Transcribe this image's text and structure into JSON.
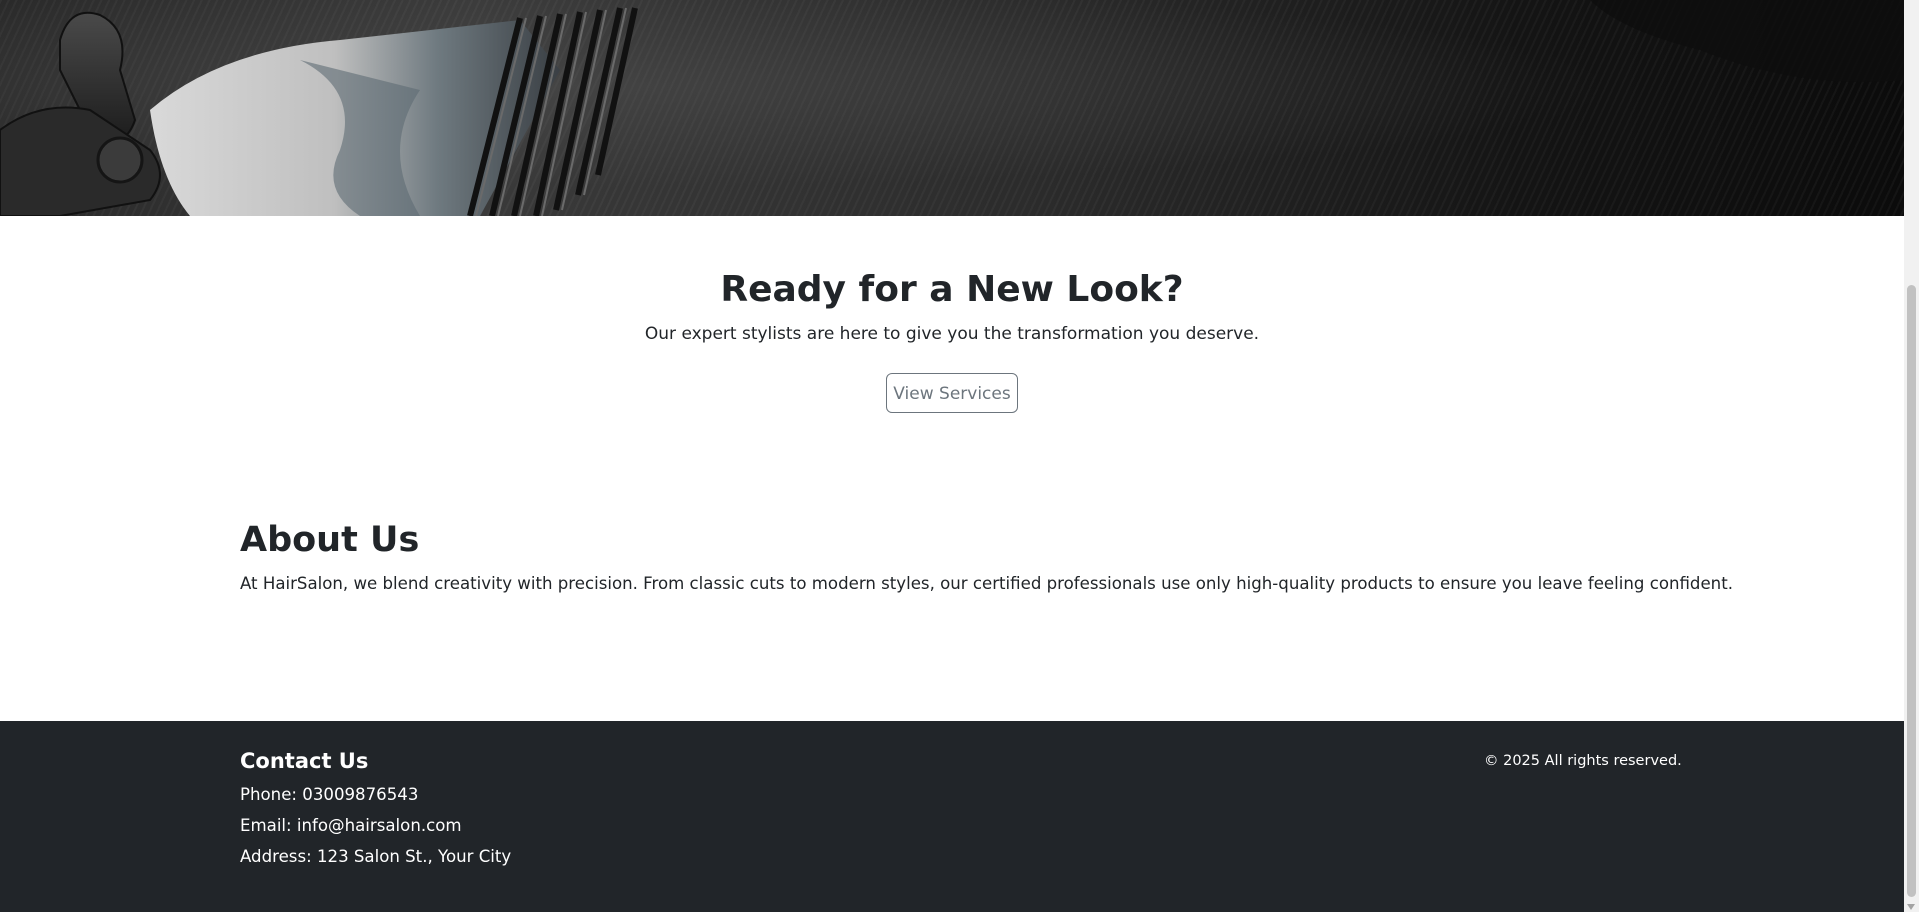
{
  "hero": {
    "image": "hair-clipper-photo"
  },
  "cta": {
    "title": "Ready for a New Look?",
    "subtitle": "Our expert stylists are here to give you the transformation you deserve.",
    "button_label": "View Services"
  },
  "about": {
    "title": "About Us",
    "text": "At HairSalon, we blend creativity with precision. From classic cuts to modern styles, our certified professionals use only high-quality products to ensure you leave feeling confident."
  },
  "footer": {
    "contact_title": "Contact Us",
    "phone": "Phone: 03009876543",
    "email": "Email: info@hairsalon.com",
    "address": "Address: 123 Salon St., Your City",
    "copyright": "© 2025 All rights reserved."
  },
  "colors": {
    "footer_bg": "#212529",
    "text": "#212529",
    "button_outline": "#6c757d"
  }
}
